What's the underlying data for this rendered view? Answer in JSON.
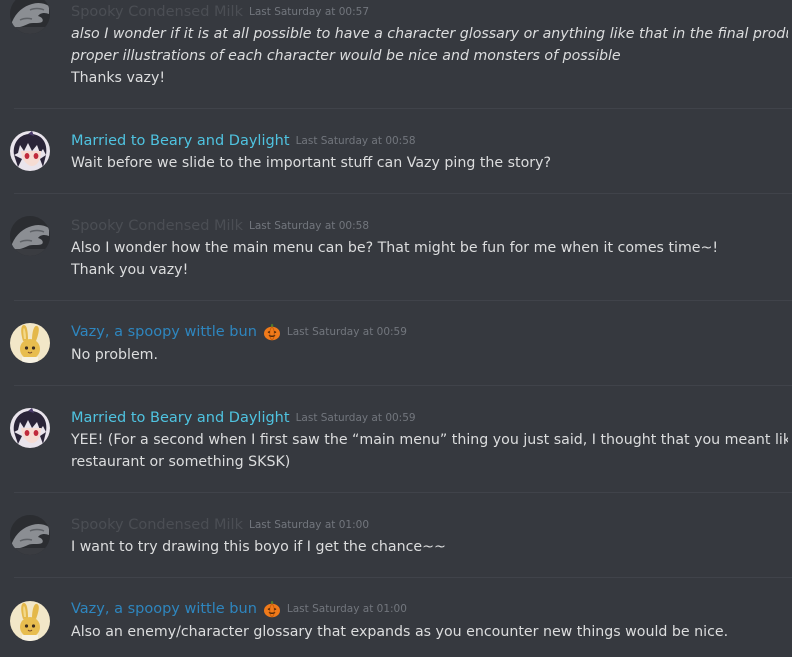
{
  "colors": {
    "background": "#36393f",
    "text": "#dcddde",
    "timestamp": "#72767d",
    "spooky_name": "#4b4e54",
    "married_name": "#4fc3e0",
    "vazy_name": "#2e86bf"
  },
  "messages": [
    {
      "author": "Spooky Condensed Milk",
      "timestamp": "Last Saturday at 00:57",
      "avatar_icon": "grey-hand-avatar",
      "lines": [
        "also I wonder if it is at all possible to have a character glossary or anything like that in the final product becaus",
        "proper illustrations of each character would be nice and monsters of possible",
        "Thanks vazy!"
      ]
    },
    {
      "author": "Married to Beary and Daylight",
      "timestamp": "Last Saturday at 00:58",
      "avatar_icon": "anime-character-avatar",
      "lines": [
        "Wait before we slide to the important stuff can Vazy ping the story?"
      ]
    },
    {
      "author": "Spooky Condensed Milk",
      "timestamp": "Last Saturday at 00:58",
      "avatar_icon": "grey-hand-avatar",
      "lines": [
        "Also I wonder how the main menu can be? That might be fun for me when it comes time~!",
        "Thank you vazy!"
      ]
    },
    {
      "author": "Vazy, a spoopy wittle bun",
      "name_emoji": "jack-o-lantern-icon",
      "timestamp": "Last Saturday at 00:59",
      "avatar_icon": "bunny-avatar",
      "lines": [
        "No problem."
      ]
    },
    {
      "author": "Married to Beary and Daylight",
      "timestamp": "Last Saturday at 00:59",
      "avatar_icon": "anime-character-avatar",
      "lines": [
        "YEE! (For a second when I first saw the “main menu” thing you just said, I thought that you meant like, a",
        "restaurant or something SKSK)"
      ]
    },
    {
      "author": "Spooky Condensed Milk",
      "timestamp": "Last Saturday at 01:00",
      "avatar_icon": "grey-hand-avatar",
      "lines": [
        "I want to try drawing this boyo if I get the chance~~"
      ]
    },
    {
      "author": "Vazy, a spoopy wittle bun",
      "name_emoji": "jack-o-lantern-icon",
      "timestamp": "Last Saturday at 01:00",
      "avatar_icon": "bunny-avatar",
      "lines": [
        "Also an enemy/character glossary that expands as you encounter new things would be nice."
      ]
    }
  ]
}
